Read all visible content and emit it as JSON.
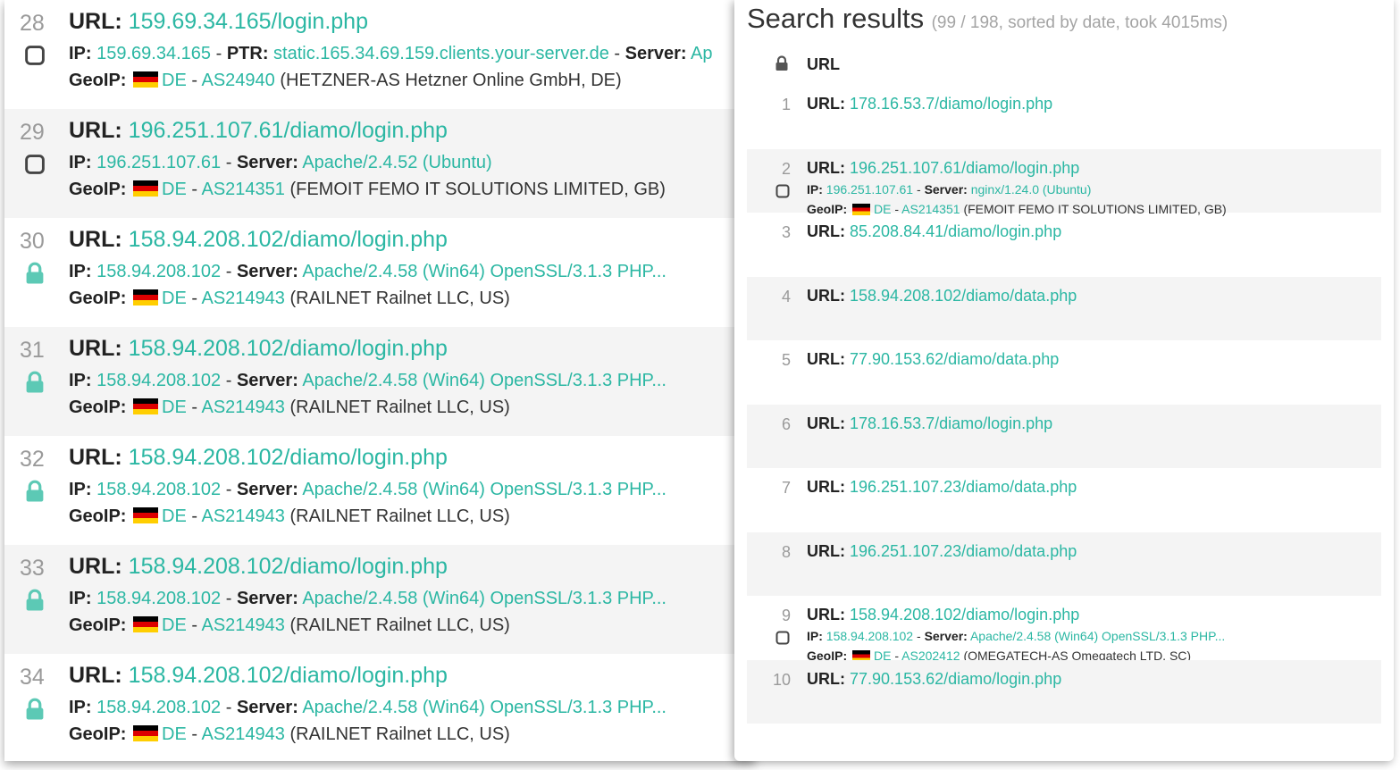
{
  "labels": {
    "url": "URL:",
    "ip": "IP:",
    "ptr": "PTR:",
    "server": "Server:",
    "geoip": "GeoIP:",
    "sep": " - "
  },
  "left_rows": [
    {
      "num": "28",
      "url": "159.69.34.165/login.php",
      "ip": "159.69.34.165",
      "ptr": "static.165.34.69.159.clients.your-server.de",
      "server": "Ap",
      "country": "DE",
      "asn": "AS24940",
      "org": "(HETZNER-AS Hetzner Online GmbH, DE)",
      "icon": "checkbox-icon"
    },
    {
      "num": "29",
      "url": "196.251.107.61/diamo/login.php",
      "ip": "196.251.107.61",
      "server": "Apache/2.4.52 (Ubuntu)",
      "country": "DE",
      "asn": "AS214351",
      "org": "(FEMOIT FEMO IT SOLUTIONS LIMITED, GB)",
      "icon": "checkbox-icon"
    },
    {
      "num": "30",
      "url": "158.94.208.102/diamo/login.php",
      "ip": "158.94.208.102",
      "server": "Apache/2.4.58 (Win64) OpenSSL/3.1.3 PHP...",
      "country": "DE",
      "asn": "AS214943",
      "org": "(RAILNET Railnet LLC, US)",
      "icon": "lock-icon"
    },
    {
      "num": "31",
      "url": "158.94.208.102/diamo/login.php",
      "ip": "158.94.208.102",
      "server": "Apache/2.4.58 (Win64) OpenSSL/3.1.3 PHP...",
      "country": "DE",
      "asn": "AS214943",
      "org": "(RAILNET Railnet LLC, US)",
      "icon": "lock-icon"
    },
    {
      "num": "32",
      "url": "158.94.208.102/diamo/login.php",
      "ip": "158.94.208.102",
      "server": "Apache/2.4.58 (Win64) OpenSSL/3.1.3 PHP...",
      "country": "DE",
      "asn": "AS214943",
      "org": "(RAILNET Railnet LLC, US)",
      "icon": "lock-icon"
    },
    {
      "num": "33",
      "url": "158.94.208.102/diamo/login.php",
      "ip": "158.94.208.102",
      "server": "Apache/2.4.58 (Win64) OpenSSL/3.1.3 PHP...",
      "country": "DE",
      "asn": "AS214943",
      "org": "(RAILNET Railnet LLC, US)",
      "icon": "lock-icon"
    },
    {
      "num": "34",
      "url": "158.94.208.102/diamo/login.php",
      "ip": "158.94.208.102",
      "server": "Apache/2.4.58 (Win64) OpenSSL/3.1.3 PHP...",
      "country": "DE",
      "asn": "AS214943",
      "org": "(RAILNET Railnet LLC, US)",
      "icon": "lock-icon"
    }
  ],
  "search": {
    "title": "Search results",
    "meta": "(99 / 198, sorted by date, took 4015ms)",
    "column_header": "URL"
  },
  "results": [
    {
      "num": "1",
      "url": "178.16.53.7/diamo/login.php"
    },
    {
      "num": "2",
      "url": "196.251.107.61/diamo/login.php",
      "ip": "196.251.107.61",
      "server": "nginx/1.24.0 (Ubuntu)",
      "country": "DE",
      "asn": "AS214351",
      "org": "(FEMOIT FEMO IT SOLUTIONS LIMITED, GB)",
      "icon": "checkbox-icon"
    },
    {
      "num": "3",
      "url": "85.208.84.41/diamo/login.php"
    },
    {
      "num": "4",
      "url": "158.94.208.102/diamo/data.php"
    },
    {
      "num": "5",
      "url": "77.90.153.62/diamo/data.php"
    },
    {
      "num": "6",
      "url": "178.16.53.7/diamo/login.php"
    },
    {
      "num": "7",
      "url": "196.251.107.23/diamo/data.php"
    },
    {
      "num": "8",
      "url": "196.251.107.23/diamo/data.php"
    },
    {
      "num": "9",
      "url": "158.94.208.102/diamo/login.php",
      "ip": "158.94.208.102",
      "server": "Apache/2.4.58 (Win64) OpenSSL/3.1.3 PHP...",
      "country": "DE",
      "asn": "AS202412",
      "org": "(OMEGATECH-AS Omegatech LTD, SC)",
      "icon": "checkbox-icon"
    },
    {
      "num": "10",
      "url": "77.90.153.62/diamo/login.php"
    }
  ],
  "colors": {
    "accent": "#2bb7a3",
    "row_alt": "#f4f4f4",
    "muted": "#9a9a9a"
  }
}
